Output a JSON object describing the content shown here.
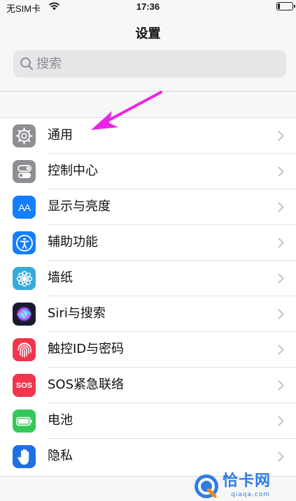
{
  "status_bar": {
    "carrier": "无SIM卡",
    "time": "17:36"
  },
  "header": {
    "title": "设置"
  },
  "search": {
    "placeholder": "搜索"
  },
  "settings": {
    "items": [
      {
        "label": "通用",
        "icon": "gear-icon",
        "color": "#8e8e93"
      },
      {
        "label": "控制中心",
        "icon": "toggles-icon",
        "color": "#8e8e93"
      },
      {
        "label": "显示与亮度",
        "icon": "text-size-icon",
        "color": "#147efb",
        "icon_text": "AA"
      },
      {
        "label": "辅助功能",
        "icon": "accessibility-icon",
        "color": "#147efb"
      },
      {
        "label": "墙纸",
        "icon": "flower-icon",
        "color": "#37aadc"
      },
      {
        "label": "Siri与搜索",
        "icon": "siri-icon",
        "color": "#1b1b2f"
      },
      {
        "label": "触控ID与密码",
        "icon": "fingerprint-icon",
        "color": "#f0354e"
      },
      {
        "label": "SOS紧急联络",
        "icon": "sos-icon",
        "color": "#f0354e",
        "icon_text": "SOS"
      },
      {
        "label": "电池",
        "icon": "battery-icon",
        "color": "#34c759"
      },
      {
        "label": "隐私",
        "icon": "hand-icon",
        "color": "#1f6fe5"
      }
    ]
  },
  "annotation": {
    "arrow_color": "#ee22e6"
  },
  "watermark": {
    "brand": "恰卡网",
    "url": "qiaqa.com",
    "color": "#2f7de1"
  }
}
